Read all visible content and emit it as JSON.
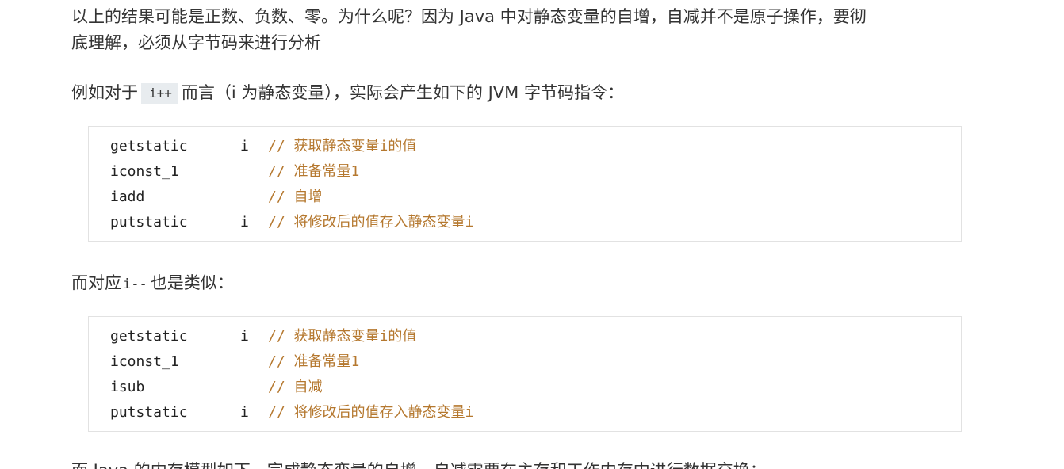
{
  "paragraphs": {
    "p1_line1": "以上的结果可能是正数、负数、零。为什么呢？因为 Java 中对静态变量的自增，自减并不是原子操作，要彻",
    "p1_line2": "底理解，必须从字节码来进行分析",
    "p2_before": "例如对于",
    "p2_code": "i++",
    "p2_after": "而言（i 为静态变量），实际会产生如下的 JVM 字节码指令：",
    "p3_before": "而对应",
    "p3_code": "i--",
    "p3_after": "也是类似：",
    "p4_partial": "而 Java 的内存模型如下，完成静态变量的自增，自减需要在主存和工作内存中进行数据交换："
  },
  "code_blocks": [
    {
      "lines": [
        {
          "op": "getstatic",
          "arg": "i",
          "comment": "// 获取静态变量i的值"
        },
        {
          "op": "iconst_1",
          "arg": "",
          "comment": "// 准备常量1"
        },
        {
          "op": "iadd",
          "arg": "",
          "comment": "// 自增"
        },
        {
          "op": "putstatic",
          "arg": "i",
          "comment": "// 将修改后的值存入静态变量i"
        }
      ]
    },
    {
      "lines": [
        {
          "op": "getstatic",
          "arg": "i",
          "comment": "// 获取静态变量i的值"
        },
        {
          "op": "iconst_1",
          "arg": "",
          "comment": "// 准备常量1"
        },
        {
          "op": "isub",
          "arg": "",
          "comment": "// 自减"
        },
        {
          "op": "putstatic",
          "arg": "i",
          "comment": "// 将修改后的值存入静态变量i"
        }
      ]
    }
  ],
  "colors": {
    "text": "#333333",
    "comment": "#b5782f",
    "inline_code_bg": "#e8ecef",
    "code_border": "#e2e2e2"
  }
}
